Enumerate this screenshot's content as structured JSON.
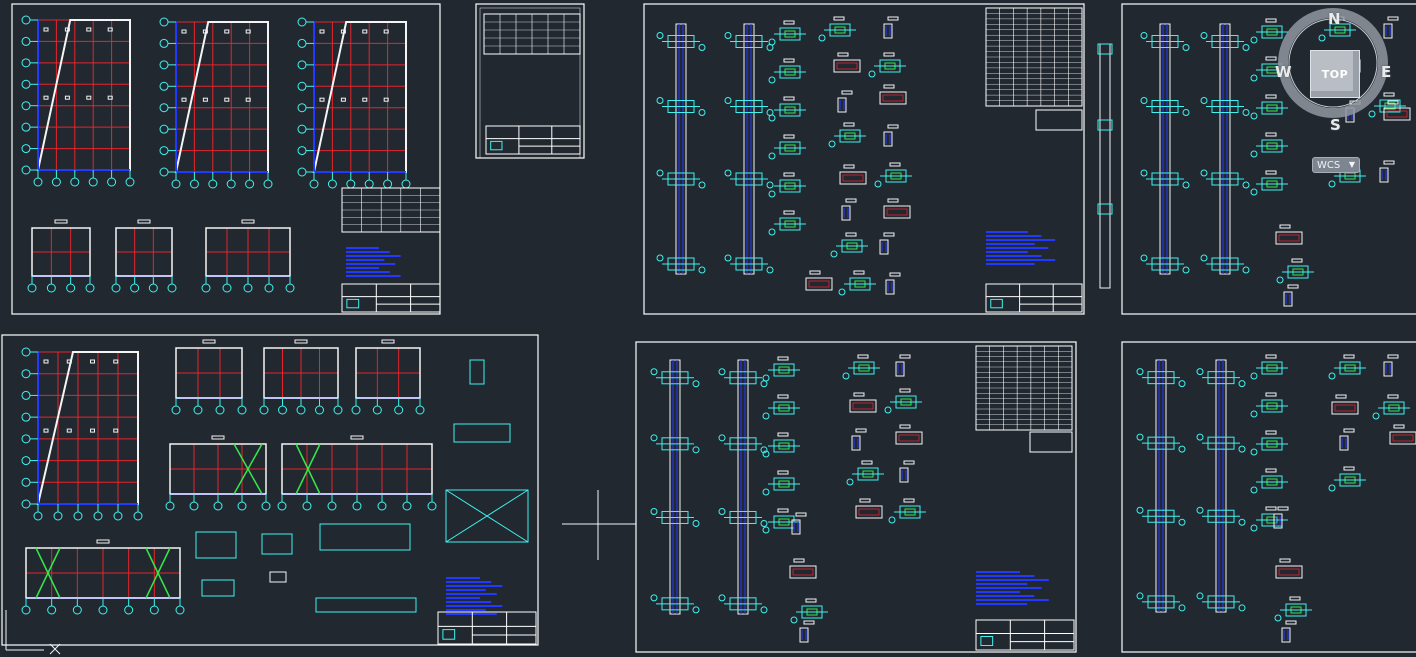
{
  "viewcube": {
    "face": "TOP",
    "north": "N",
    "south": "S",
    "east": "E",
    "west": "W"
  },
  "ucs": {
    "label": "WCS"
  },
  "colors": {
    "background": "#212830",
    "border": "#ffffff",
    "grid_red": "#e8242c",
    "blue": "#2439ff",
    "cyan": "#3ff2ee",
    "green": "#35e84a",
    "label_white": "#f4f4f4"
  }
}
